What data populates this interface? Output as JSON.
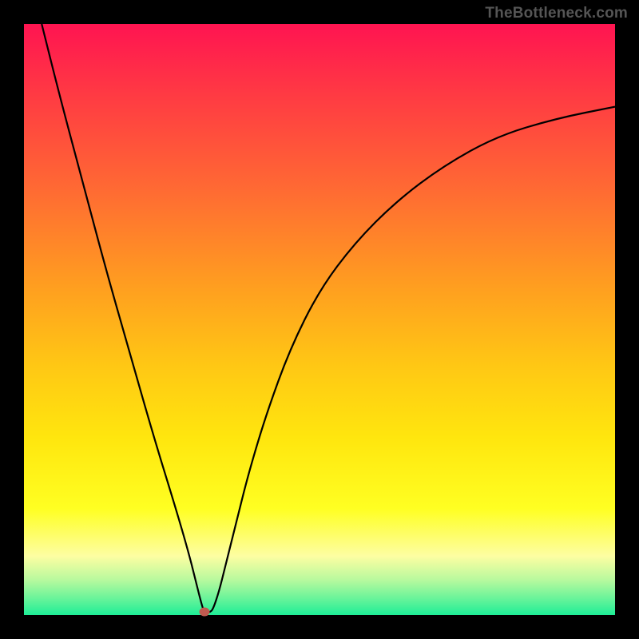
{
  "watermark": "TheBottleneck.com",
  "colors": {
    "background": "#000000",
    "gradient_top": "#ff1451",
    "gradient_bottom": "#1eee97",
    "curve": "#000000",
    "marker": "#c05a50"
  },
  "chart_data": {
    "type": "line",
    "title": "",
    "xlabel": "",
    "ylabel": "",
    "xlim": [
      0,
      100
    ],
    "ylim": [
      0,
      100
    ],
    "x": [
      3,
      6,
      10,
      14,
      18,
      22,
      26,
      28,
      29,
      30,
      30.5,
      31,
      31.5,
      32,
      33,
      34,
      36,
      38,
      41,
      45,
      50,
      56,
      63,
      71,
      80,
      90,
      100
    ],
    "values": [
      100,
      88,
      73,
      58,
      44,
      30,
      17,
      10,
      6,
      2,
      0.5,
      0.5,
      0.5,
      1,
      4,
      8,
      16,
      24,
      34,
      45,
      55,
      63,
      70,
      76,
      81,
      84,
      86
    ],
    "annotations": [
      {
        "type": "marker",
        "x": 30.5,
        "y": 0.5,
        "label": "minimum"
      }
    ]
  }
}
